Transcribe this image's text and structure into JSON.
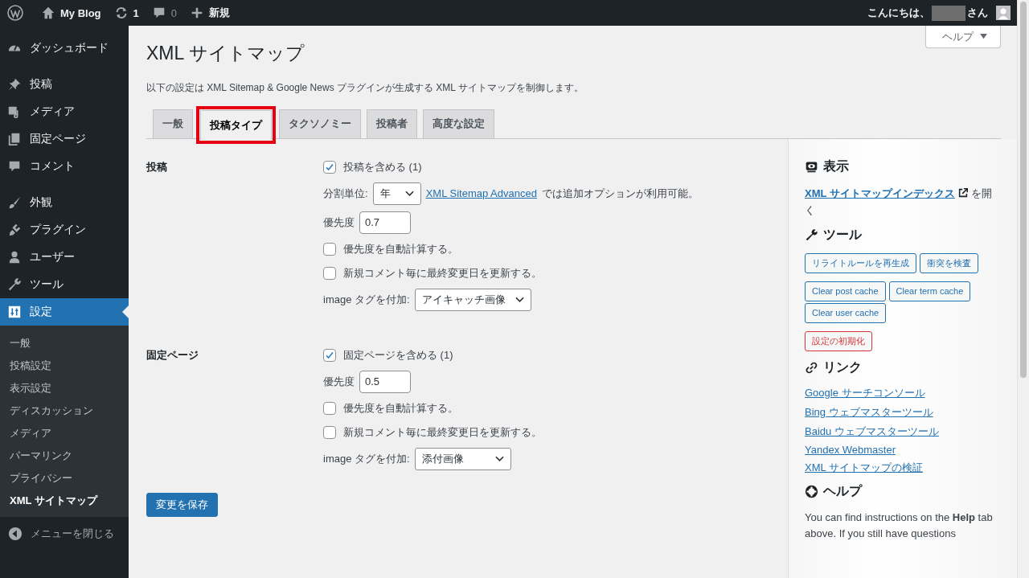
{
  "admin_bar": {
    "site": "My Blog",
    "updates": "1",
    "comments": "0",
    "new": "新規",
    "greeting": "こんにちは、",
    "honorific": "さん"
  },
  "menu": {
    "groups": [
      [
        {
          "label": "ダッシュボード",
          "selected": false
        }
      ],
      [
        {
          "label": "投稿",
          "selected": false
        },
        {
          "label": "メディア",
          "selected": false
        },
        {
          "label": "固定ページ",
          "selected": false
        },
        {
          "label": "コメント",
          "selected": false
        }
      ],
      [
        {
          "label": "外観",
          "selected": false
        },
        {
          "label": "プラグイン",
          "selected": false
        },
        {
          "label": "ユーザー",
          "selected": false
        },
        {
          "label": "ツール",
          "selected": false
        },
        {
          "label": "設定",
          "selected": true
        }
      ]
    ],
    "submenu": [
      {
        "label": "一般",
        "selected": false
      },
      {
        "label": "投稿設定",
        "selected": false
      },
      {
        "label": "表示設定",
        "selected": false
      },
      {
        "label": "ディスカッション",
        "selected": false
      },
      {
        "label": "メディア",
        "selected": false
      },
      {
        "label": "パーマリンク",
        "selected": false
      },
      {
        "label": "プライバシー",
        "selected": false
      },
      {
        "label": "XML サイトマップ",
        "selected": true
      }
    ],
    "collapse": "メニューを閉じる"
  },
  "help_button": "ヘルプ",
  "page": {
    "title": "XML サイトマップ",
    "description": "以下の設定は XML Sitemap & Google News プラグインが生成する XML サイトマップを制御します。"
  },
  "tabs": [
    {
      "label": "一般",
      "selected": false,
      "highlighted": false
    },
    {
      "label": "投稿タイプ",
      "selected": true,
      "highlighted": true
    },
    {
      "label": "タクソノミー",
      "selected": false,
      "highlighted": false
    },
    {
      "label": "投稿者",
      "selected": false,
      "highlighted": false
    },
    {
      "label": "高度な設定",
      "selected": false,
      "highlighted": false
    }
  ],
  "sections": [
    {
      "title": "投稿",
      "fields": [
        {
          "kind": "checkbox",
          "label": "投稿を含める (1)",
          "checked": true
        },
        {
          "kind": "select",
          "label": "分割単位:",
          "value": "年",
          "link": "XML Sitemap Advanced",
          "note": "では追加オプションが利用可能。"
        },
        {
          "kind": "number",
          "label": "優先度",
          "value": "0.7"
        },
        {
          "kind": "checkbox",
          "label": "優先度を自動計算する。",
          "checked": false
        },
        {
          "kind": "checkbox",
          "label": "新規コメント毎に最終変更日を更新する。",
          "checked": false
        },
        {
          "kind": "select",
          "label": "image タグを付加:",
          "value": "アイキャッチ画像"
        }
      ]
    },
    {
      "title": "固定ページ",
      "fields": [
        {
          "kind": "checkbox",
          "label": "固定ページを含める (1)",
          "checked": true
        },
        {
          "kind": "number",
          "label": "優先度",
          "value": "0.5"
        },
        {
          "kind": "checkbox",
          "label": "優先度を自動計算する。",
          "checked": false
        },
        {
          "kind": "checkbox",
          "label": "新規コメント毎に最終変更日を更新する。",
          "checked": false
        },
        {
          "kind": "select",
          "label": "image タグを付加:",
          "value": "添付画像"
        }
      ]
    }
  ],
  "save_button": "変更を保存",
  "side": {
    "view": {
      "heading": "表示",
      "link": "XML サイトマップインデックス",
      "after": "を開く"
    },
    "tools": {
      "heading": "ツール",
      "groups": [
        [
          {
            "label": "リライトルールを再生成",
            "kind": "default"
          },
          {
            "label": "衝突を検査",
            "kind": "default"
          }
        ],
        [
          {
            "label": "Clear post cache",
            "kind": "default"
          },
          {
            "label": "Clear term cache",
            "kind": "default"
          },
          {
            "label": "Clear user cache",
            "kind": "default"
          }
        ],
        [
          {
            "label": "設定の初期化",
            "kind": "danger"
          }
        ]
      ]
    },
    "links": {
      "heading": "リンク",
      "items": [
        "Google サーチコンソール",
        "Bing ウェブマスターツール",
        "Baidu ウェブマスターツール",
        "Yandex Webmaster",
        "XML サイトマップの検証"
      ]
    },
    "help": {
      "heading": "ヘルプ",
      "text": "You can find instructions on the **Help** tab above. If you still have questions"
    }
  }
}
